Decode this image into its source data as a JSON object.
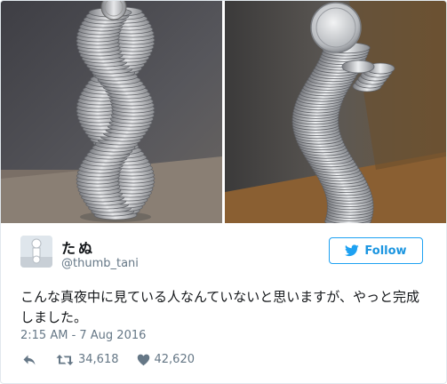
{
  "tweet": {
    "display_name": "たぬ",
    "handle": "@thumb_tani",
    "follow_label": "Follow",
    "text": "こんな真夜中に見ている人なんていないと思いますが、やっと完成しました。",
    "timestamp": "2:15 AM - 7 Aug 2016",
    "retweet_count": "34,618",
    "like_count": "42,620"
  },
  "colors": {
    "accent": "#1da1f2",
    "muted": "#657786",
    "text": "#14171a"
  },
  "icons": {
    "follow": "twitter-bird-icon",
    "reply": "reply-icon",
    "retweet": "retweet-icon",
    "like": "heart-icon"
  }
}
